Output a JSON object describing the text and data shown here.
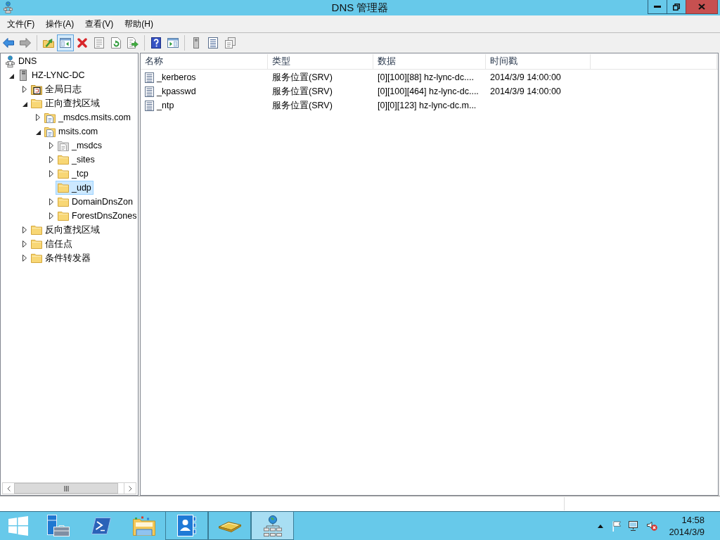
{
  "window": {
    "title": "DNS 管理器"
  },
  "menu": [
    {
      "label": "文件(F)"
    },
    {
      "label": "操作(A)"
    },
    {
      "label": "查看(V)"
    },
    {
      "label": "帮助(H)"
    }
  ],
  "toolbar": [
    {
      "buttons": [
        {
          "kind": "back",
          "pressed": false,
          "disabled": false
        },
        {
          "kind": "forward",
          "pressed": false,
          "disabled": true
        }
      ]
    },
    {
      "buttons": [
        {
          "kind": "folder-up",
          "pressed": false,
          "disabled": false
        },
        {
          "kind": "console-tree",
          "pressed": true,
          "disabled": false
        },
        {
          "kind": "delete",
          "pressed": false,
          "disabled": false
        },
        {
          "kind": "properties",
          "pressed": false,
          "disabled": false
        },
        {
          "kind": "refresh",
          "pressed": false,
          "disabled": false
        },
        {
          "kind": "export",
          "pressed": false,
          "disabled": false
        }
      ]
    },
    {
      "buttons": [
        {
          "kind": "help",
          "pressed": false,
          "disabled": false
        },
        {
          "kind": "action-pane",
          "pressed": false,
          "disabled": false
        }
      ]
    },
    {
      "buttons": [
        {
          "kind": "server",
          "pressed": false,
          "disabled": false
        },
        {
          "kind": "record-list",
          "pressed": false,
          "disabled": false
        },
        {
          "kind": "copy",
          "pressed": false,
          "disabled": false
        }
      ]
    }
  ],
  "tree": [
    {
      "label": "DNS",
      "kind": "dns",
      "selected": false,
      "children": [
        {
          "label": "HZ-LYNC-DC",
          "kind": "server",
          "expanded": true,
          "selected": false,
          "children": [
            {
              "label": "全局日志",
              "kind": "log",
              "expanded": false,
              "selected": false
            },
            {
              "label": "正向查找区域",
              "kind": "folder",
              "expanded": true,
              "selected": false,
              "children": [
                {
                  "label": "_msdcs.msits.com",
                  "kind": "zone",
                  "expanded": false,
                  "selected": false
                },
                {
                  "label": "msits.com",
                  "kind": "zone",
                  "expanded": true,
                  "selected": false,
                  "children": [
                    {
                      "label": "_msdcs",
                      "kind": "delegation",
                      "expanded": false,
                      "selected": false
                    },
                    {
                      "label": "_sites",
                      "kind": "folder",
                      "expanded": false,
                      "selected": false
                    },
                    {
                      "label": "_tcp",
                      "kind": "folder",
                      "expanded": false,
                      "selected": false
                    },
                    {
                      "label": "_udp",
                      "kind": "folder",
                      "selected": true
                    },
                    {
                      "label": "DomainDnsZon",
                      "kind": "folder",
                      "expanded": false,
                      "selected": false
                    },
                    {
                      "label": "ForestDnsZones",
                      "kind": "folder",
                      "expanded": false,
                      "selected": false
                    }
                  ]
                }
              ]
            },
            {
              "label": "反向查找区域",
              "kind": "folder",
              "expanded": false,
              "selected": false
            },
            {
              "label": "信任点",
              "kind": "folder",
              "expanded": false,
              "selected": false
            },
            {
              "label": "条件转发器",
              "kind": "folder",
              "expanded": false,
              "selected": false
            }
          ]
        }
      ]
    }
  ],
  "list": {
    "columns": [
      "名称",
      "类型",
      "数据",
      "时间戳"
    ],
    "rows": [
      {
        "cells": [
          "_kerberos",
          "服务位置(SRV)",
          "[0][100][88] hz-lync-dc....",
          "2014/3/9 14:00:00"
        ],
        "selected": false
      },
      {
        "cells": [
          "_kpasswd",
          "服务位置(SRV)",
          "[0][100][464] hz-lync-dc....",
          "2014/3/9 14:00:00"
        ],
        "selected": false
      },
      {
        "cells": [
          "_ntp",
          "服务位置(SRV)",
          "[0][0][123] hz-lync-dc.m..."
        ],
        "selected": false
      }
    ]
  },
  "taskbar": {
    "buttons": [
      {
        "kind": "start",
        "running": false,
        "selected": false
      },
      {
        "kind": "server-manager",
        "running": false,
        "selected": false
      },
      {
        "kind": "powershell",
        "running": false,
        "selected": false
      },
      {
        "kind": "explorer",
        "running": false,
        "selected": false
      },
      {
        "kind": "contacts",
        "running": true,
        "selected": false
      },
      {
        "kind": "book",
        "running": true,
        "selected": false
      },
      {
        "kind": "dns",
        "running": true,
        "selected": true
      }
    ],
    "clock": {
      "time": "14:58",
      "date": "2014/3/9"
    }
  }
}
